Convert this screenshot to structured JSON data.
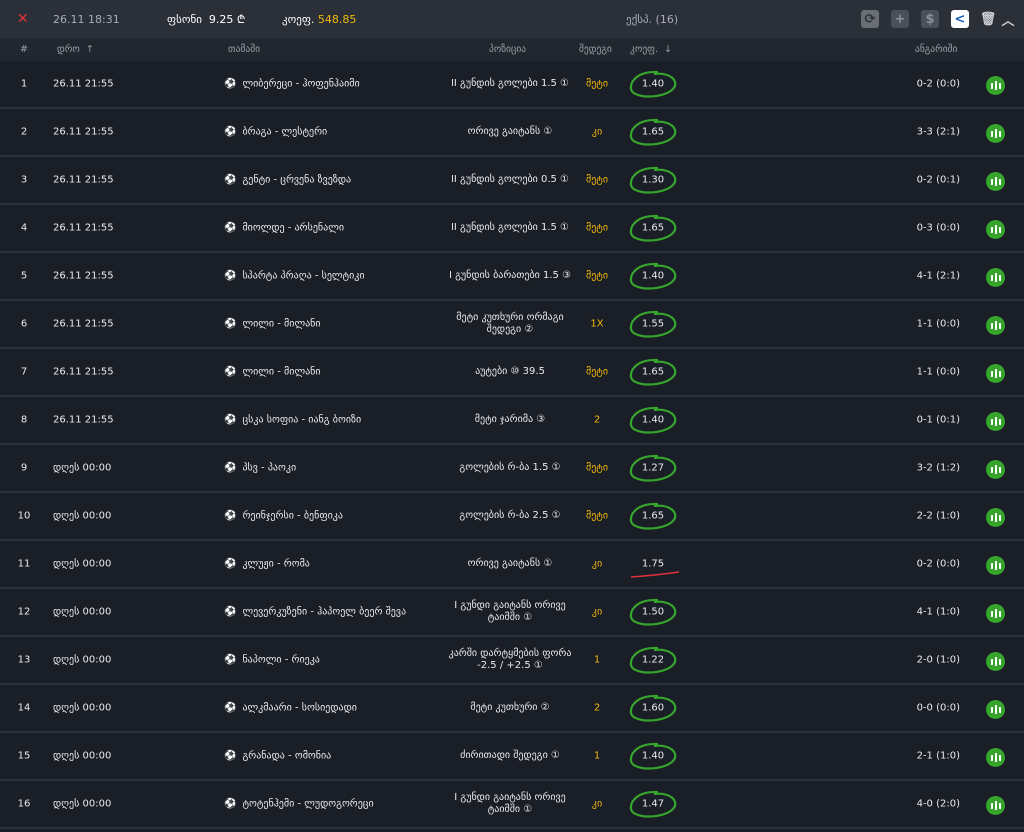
{
  "header": {
    "datetime": "26.11  18:31",
    "stake_label": "ფსონი",
    "stake_value": "9.25 ₾",
    "odds_label": "კოეფ.",
    "odds_value": "548.85",
    "express": "ექსპ. (16)"
  },
  "columns": {
    "num": "#",
    "date": "დრო",
    "game": "თამაში",
    "position": "პოზიცია",
    "result": "შედეგი",
    "odds": "კოეფ.",
    "score": "ანგარიში"
  },
  "colors": {
    "accent": "#f0b90b",
    "win": "#35a52c",
    "loss": "#e0333a"
  },
  "rows": [
    {
      "num": "1",
      "date": "26.11  21:55",
      "game": "ლიბერეცი - ჰოფენჰაიმი",
      "position": "II გუნდის გოლები 1.5 ①",
      "result": "მეტი",
      "odds": "1.40",
      "score": "0-2 (0:0)",
      "won": true
    },
    {
      "num": "2",
      "date": "26.11  21:55",
      "game": "ბრაგა - ლესტერი",
      "position": "ორივე გაიტანს ①",
      "result": "კი",
      "odds": "1.65",
      "score": "3-3 (2:1)",
      "won": true
    },
    {
      "num": "3",
      "date": "26.11  21:55",
      "game": "გენტი - ცრვენა ზვეზდა",
      "position": "II გუნდის გოლები 0.5 ①",
      "result": "მეტი",
      "odds": "1.30",
      "score": "0-2 (0:1)",
      "won": true
    },
    {
      "num": "4",
      "date": "26.11  21:55",
      "game": "მიოლდე - არსენალი",
      "position": "II გუნდის გოლები 1.5 ①",
      "result": "მეტი",
      "odds": "1.65",
      "score": "0-3 (0:0)",
      "won": true
    },
    {
      "num": "5",
      "date": "26.11  21:55",
      "game": "სპარტა პრაღა - სელტიკი",
      "position": "I გუნდის ბარათები 1.5 ③",
      "result": "მეტი",
      "odds": "1.40",
      "score": "4-1 (2:1)",
      "won": true
    },
    {
      "num": "6",
      "date": "26.11  21:55",
      "game": "ლილი - მილანი",
      "position": "მეტი კუთხური ორმაგი შედეგი ②",
      "result": "1X",
      "odds": "1.55",
      "score": "1-1 (0:0)",
      "won": true
    },
    {
      "num": "7",
      "date": "26.11  21:55",
      "game": "ლილი - მილანი",
      "position": "აუტები ⑩ 39.5",
      "result": "მეტი",
      "odds": "1.65",
      "score": "1-1 (0:0)",
      "won": true
    },
    {
      "num": "8",
      "date": "26.11  21:55",
      "game": "ცსკა სოფია - იანგ ბოიზი",
      "position": "მეტი ჯარიმა ③",
      "result": "2",
      "odds": "1.40",
      "score": "0-1 (0:1)",
      "won": true
    },
    {
      "num": "9",
      "date": "დღეს  00:00",
      "game": "პსვ - პაოკი",
      "position": "გოლების რ-ბა 1.5 ①",
      "result": "მეტი",
      "odds": "1.27",
      "score": "3-2 (1:2)",
      "won": true
    },
    {
      "num": "10",
      "date": "დღეს  00:00",
      "game": "რეინჯერსი - ბენფიკა",
      "position": "გოლების რ-ბა 2.5 ①",
      "result": "მეტი",
      "odds": "1.65",
      "score": "2-2 (1:0)",
      "won": true
    },
    {
      "num": "11",
      "date": "დღეს  00:00",
      "game": "კლუჟი - რომა",
      "position": "ორივე გაიტანს ①",
      "result": "კი",
      "odds": "1.75",
      "score": "0-2 (0:0)",
      "won": false
    },
    {
      "num": "12",
      "date": "დღეს  00:00",
      "game": "ლევერკუზენი - ჰაპოელ ბეერ შევა",
      "position": "I გუნდი გაიტანს ორივე ტაიმში ①",
      "result": "კი",
      "odds": "1.50",
      "score": "4-1 (1:0)",
      "won": true
    },
    {
      "num": "13",
      "date": "დღეს  00:00",
      "game": "ნაპოლი - რიეკა",
      "position": "კარში დარტყმების ფორა -2.5 / +2.5 ①",
      "result": "1",
      "odds": "1.22",
      "score": "2-0 (1:0)",
      "won": true
    },
    {
      "num": "14",
      "date": "დღეს  00:00",
      "game": "ალკმაარი - სოსიედადი",
      "position": "მეტი კუთხური ②",
      "result": "2",
      "odds": "1.60",
      "score": "0-0 (0:0)",
      "won": true
    },
    {
      "num": "15",
      "date": "დღეს  00:00",
      "game": "გრანადა - ომონია",
      "position": "ძირითადი შედეგი ①",
      "result": "1",
      "odds": "1.40",
      "score": "2-1 (1:0)",
      "won": true
    },
    {
      "num": "16",
      "date": "დღეს  00:00",
      "game": "ტოტენჰემი - ლუდოგორეცი",
      "position": "I გუნდი გაიტანს ორივე ტაიმში ①",
      "result": "კი",
      "odds": "1.47",
      "score": "4-0 (2:0)",
      "won": true
    }
  ]
}
